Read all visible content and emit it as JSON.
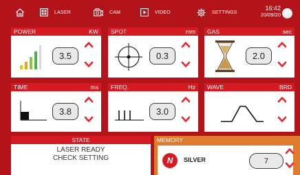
{
  "nav": {
    "items": [
      {
        "id": "home",
        "icon": "home-icon",
        "label": ""
      },
      {
        "id": "laser",
        "icon": "laser-grid-icon",
        "label": "LASER"
      },
      {
        "id": "cam",
        "icon": "camera-icon",
        "label": "CAM"
      },
      {
        "id": "video",
        "icon": "video-icon",
        "label": "VIDEO"
      },
      {
        "id": "settings",
        "icon": "gear-icon",
        "label": "SETTINGS"
      }
    ],
    "time": "16:42",
    "date": "20/09/20"
  },
  "panels": {
    "power": {
      "title": "POWER",
      "unit": "KW",
      "value": "3.5",
      "icon": "signal-bars-icon"
    },
    "spot": {
      "title": "SPOT",
      "unit": "mm",
      "value": "0.3",
      "icon": "crosshair-icon"
    },
    "gas": {
      "title": "GAS",
      "unit": "sec",
      "value": "2.0",
      "icon": "hourglass-icon"
    },
    "time": {
      "title": "TIME",
      "unit": "ms",
      "value": "3.8",
      "icon": "pulse-step-icon"
    },
    "freq": {
      "title": "FREQ.",
      "unit": "Hz",
      "value": "3.0",
      "icon": "pulse-train-icon"
    },
    "wave": {
      "title": "WAVE",
      "unit": "BRD",
      "icon": "trapezoid-wave-icon"
    }
  },
  "state": {
    "title": "STATE",
    "line1": "LASER READY",
    "line2": "CHECK SETTING"
  },
  "memory": {
    "title": "MEMORY",
    "badge": "N",
    "name": "SILVER",
    "slot": "7"
  },
  "colors": {
    "background": "#b3141a",
    "accent_red": "#d61a22",
    "memory_orange": "#e07a2c",
    "chevron": "#e8242c"
  }
}
